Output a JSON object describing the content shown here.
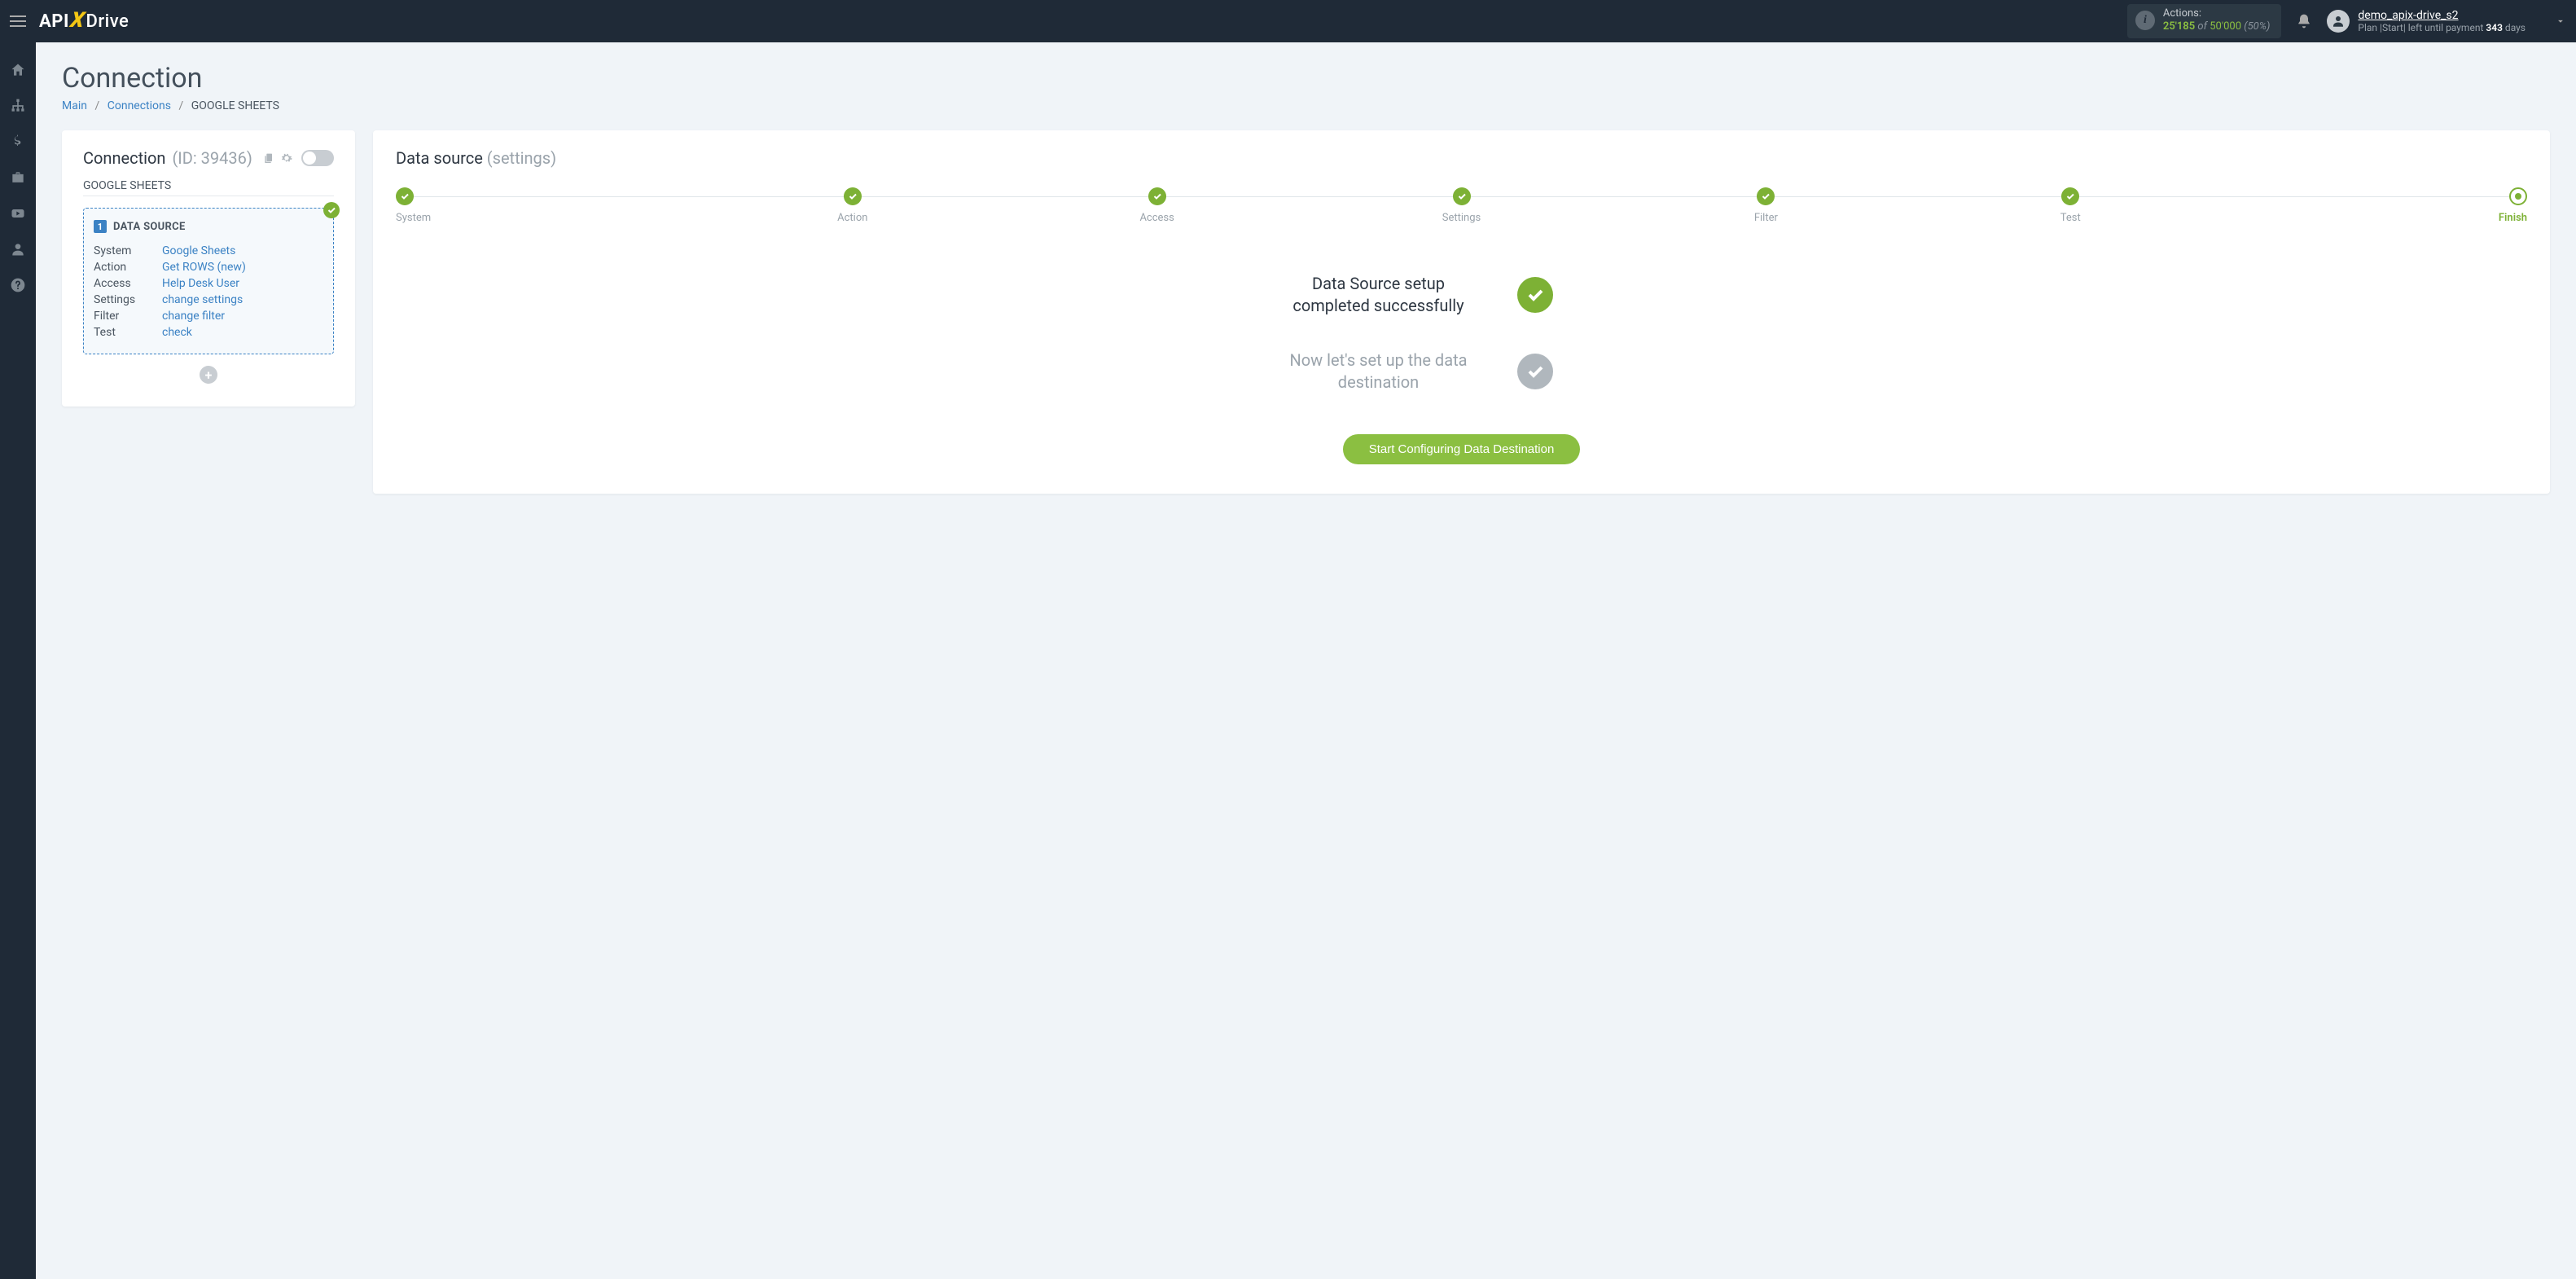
{
  "header": {
    "logo": {
      "part1": "API",
      "part2": "X",
      "part3": "Drive"
    },
    "actions": {
      "label": "Actions:",
      "used": "25'185",
      "of": "of",
      "total": "50'000",
      "pct": "(50%)"
    },
    "user": {
      "name": "demo_apix-drive_s2",
      "plan_prefix": "Plan |",
      "plan_name": "Start",
      "plan_mid": "| left until payment",
      "days_num": "343",
      "days_suffix": "days"
    }
  },
  "page": {
    "title": "Connection",
    "breadcrumb": {
      "main": "Main",
      "connections": "Connections",
      "current": "GOOGLE SHEETS"
    }
  },
  "left": {
    "heading": "Connection",
    "id_label": "(ID: 39436)",
    "subtitle": "GOOGLE SHEETS",
    "card": {
      "num": "1",
      "title": "DATA SOURCE",
      "rows": [
        {
          "key": "System",
          "val": "Google Sheets"
        },
        {
          "key": "Action",
          "val": "Get ROWS (new)"
        },
        {
          "key": "Access",
          "val": "Help Desk User"
        },
        {
          "key": "Settings",
          "val": "change settings"
        },
        {
          "key": "Filter",
          "val": "change filter"
        },
        {
          "key": "Test",
          "val": "check"
        }
      ]
    },
    "add_label": "+"
  },
  "right": {
    "title": "Data source",
    "subtitle": "(settings)",
    "steps": [
      {
        "label": "System",
        "state": "done"
      },
      {
        "label": "Action",
        "state": "done"
      },
      {
        "label": "Access",
        "state": "done"
      },
      {
        "label": "Settings",
        "state": "done"
      },
      {
        "label": "Filter",
        "state": "done"
      },
      {
        "label": "Test",
        "state": "done"
      },
      {
        "label": "Finish",
        "state": "current"
      }
    ],
    "status": {
      "done_text": "Data Source setup completed successfully",
      "pending_text": "Now let's set up the data destination",
      "cta": "Start Configuring Data Destination"
    }
  }
}
